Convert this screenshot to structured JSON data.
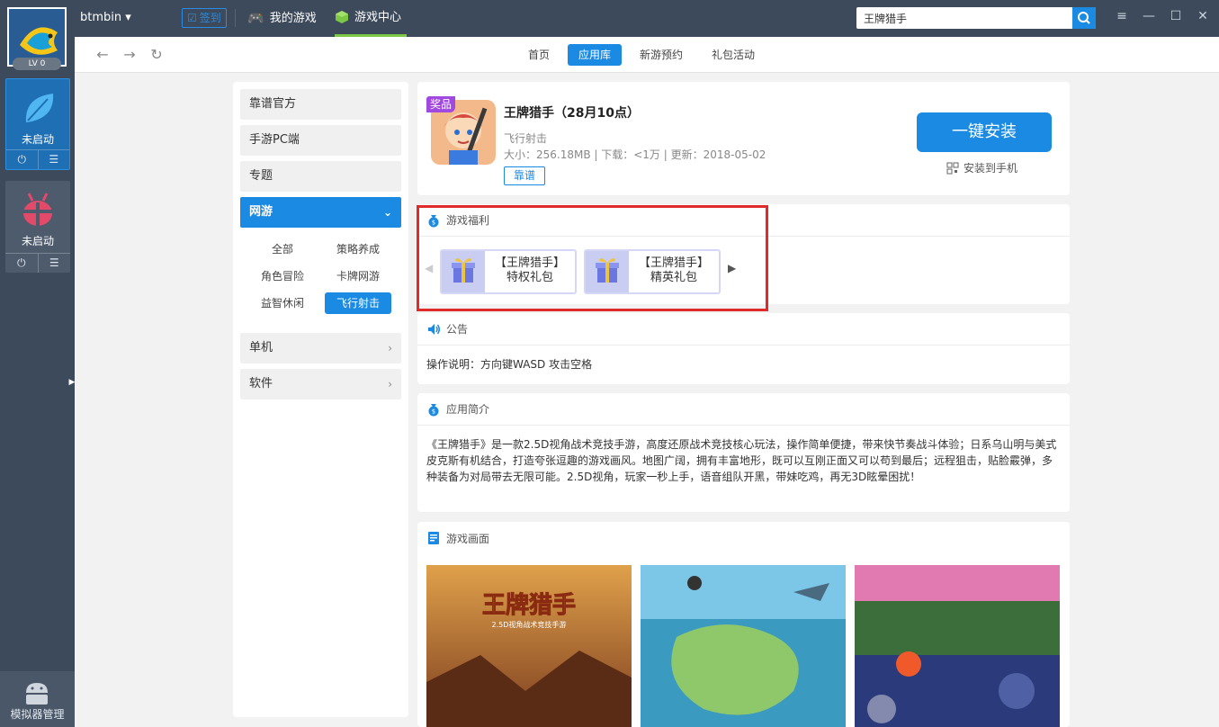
{
  "rail": {
    "level": "LV 0",
    "emulators": [
      {
        "label": "未启动",
        "power": "⏻",
        "menu": "☰"
      },
      {
        "label": "未启动",
        "power": "⏻",
        "menu": "☰"
      }
    ],
    "bottom_label": "模拟器管理"
  },
  "topbar": {
    "username": "btmbin",
    "signin": "签到",
    "tabs": [
      {
        "label": "我的游戏"
      },
      {
        "label": "游戏中心"
      }
    ],
    "search_value": "王牌猎手"
  },
  "subnav": {
    "tabs": [
      {
        "label": "首页"
      },
      {
        "label": "应用库"
      },
      {
        "label": "新游预约"
      },
      {
        "label": "礼包活动"
      }
    ]
  },
  "categories": {
    "main": [
      {
        "label": "靠谱官方"
      },
      {
        "label": "手游PC端"
      },
      {
        "label": "专题"
      },
      {
        "label": "网游"
      },
      {
        "label": "单机"
      },
      {
        "label": "软件"
      }
    ],
    "sub": [
      {
        "label": "全部"
      },
      {
        "label": "策略养成"
      },
      {
        "label": "角色冒险"
      },
      {
        "label": "卡牌网游"
      },
      {
        "label": "益智休闲"
      },
      {
        "label": "飞行射击"
      }
    ]
  },
  "app": {
    "badge": "奖品",
    "title": "王牌猎手（28月10点）",
    "category": "飞行射击",
    "meta": "大小：256.18MB | 下载：<1万 | 更新：2018-05-02",
    "tag": "靠谱",
    "install_label": "一键安装",
    "install_phone_label": "安装到手机"
  },
  "welfare": {
    "title": "游戏福利",
    "gifts": [
      {
        "line1": "【王牌猎手】",
        "line2": "特权礼包"
      },
      {
        "line1": "【王牌猎手】",
        "line2": "精英礼包"
      }
    ]
  },
  "notice": {
    "title": "公告",
    "text": "操作说明：方向键WASD 攻击空格"
  },
  "intro": {
    "title": "应用简介",
    "text": "《王牌猎手》是一款2.5D视角战术竞技手游，高度还原战术竞技核心玩法，操作简单便捷，带来快节奏战斗体验；日系乌山明与美式皮克斯有机结合，打造夸张逗趣的游戏画风。地图广阔，拥有丰富地形，既可以互刚正面又可以苟到最后；远程狙击，贴脸霰弹，多种装备为对局带去无限可能。2.5D视角，玩家一秒上手，语音组队开黑，带妹吃鸡，再无3D眩晕困扰！"
  },
  "screens": {
    "title": "游戏画面",
    "logo_text": "王牌猎手",
    "logo_sub": "2.5D视角战术竞技手游"
  },
  "colors": {
    "accent": "#1a8ae3",
    "rail": "#3c4a5c",
    "highlight": "#e02b2b",
    "gift_purple": "#a048e0"
  }
}
